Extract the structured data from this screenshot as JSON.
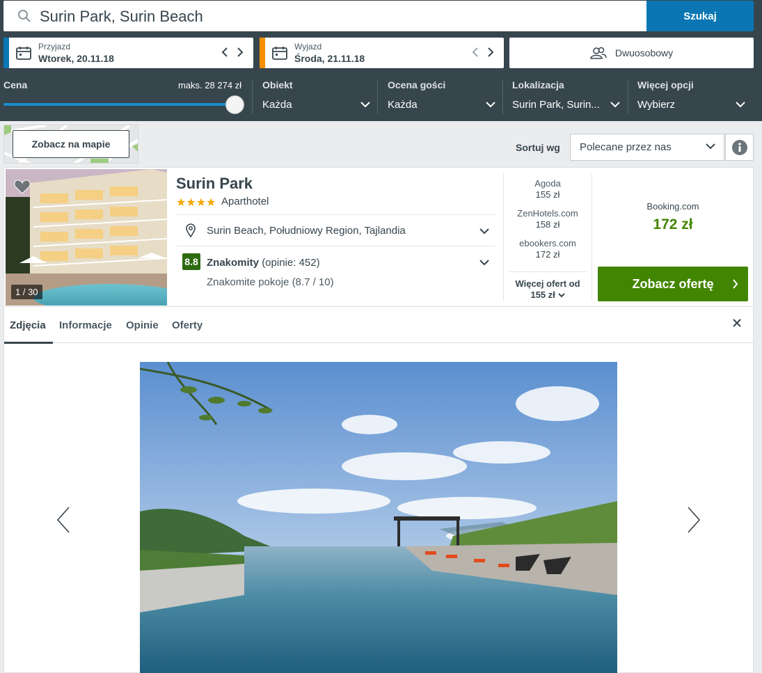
{
  "search": {
    "query": "Surin Park, Surin Beach",
    "button_label": "Szukaj"
  },
  "checkin": {
    "label": "Przyjazd",
    "value": "Wtorek, 20.11.18",
    "stripe_color": "#0a77b4"
  },
  "checkout": {
    "label": "Wyjazd",
    "value": "Środa, 21.11.18",
    "stripe_color": "#f48f00"
  },
  "room": {
    "label": "Dwuosobowy"
  },
  "filters": {
    "price": {
      "label": "Cena",
      "max": "maks. 28 274 zł",
      "level": 1.0
    },
    "object": {
      "label": "Obiekt",
      "value": "Każda"
    },
    "rating": {
      "label": "Ocena gości",
      "value": "Każda"
    },
    "location": {
      "label": "Lokalizacja",
      "value": "Surin Park, Surin..."
    },
    "more": {
      "label": "Więcej opcji",
      "value": "Wybierz"
    }
  },
  "map": {
    "button_label": "Zobacz na mapie"
  },
  "sort": {
    "label": "Sortuj wg",
    "value": "Polecane przez nas"
  },
  "hotel": {
    "photo_count": "1 / 30",
    "name": "Surin Park",
    "stars": "★★★★",
    "type": "Aparthotel",
    "location": "Surin Beach, Południowy Region, Tajlandia",
    "rating_score": "8.8",
    "rating_label": "Znakomity",
    "rating_reviews": "(opinie: 452)",
    "rating_sub": "Znakomite pokoje (8.7 / 10)"
  },
  "alt_deals": [
    {
      "site": "Agoda",
      "price": "155 zł"
    },
    {
      "site": "ZenHotels.com",
      "price": "158 zł"
    },
    {
      "site": "ebookers.com",
      "price": "172 zł"
    }
  ],
  "more_offers": {
    "line1": "Więcej ofert od",
    "line2": "155 zł"
  },
  "main_deal": {
    "site": "Booking.com",
    "price": "172 zł",
    "button_label": "Zobacz ofertę"
  },
  "tabs": [
    {
      "label": "Zdjęcia"
    },
    {
      "label": "Informacje"
    },
    {
      "label": "Opinie"
    },
    {
      "label": "Oferty"
    }
  ],
  "colors": {
    "accent_blue": "#0a77b4",
    "deal_green": "#428500",
    "rating_green": "#2c6b11",
    "header_dark": "#37454d"
  }
}
